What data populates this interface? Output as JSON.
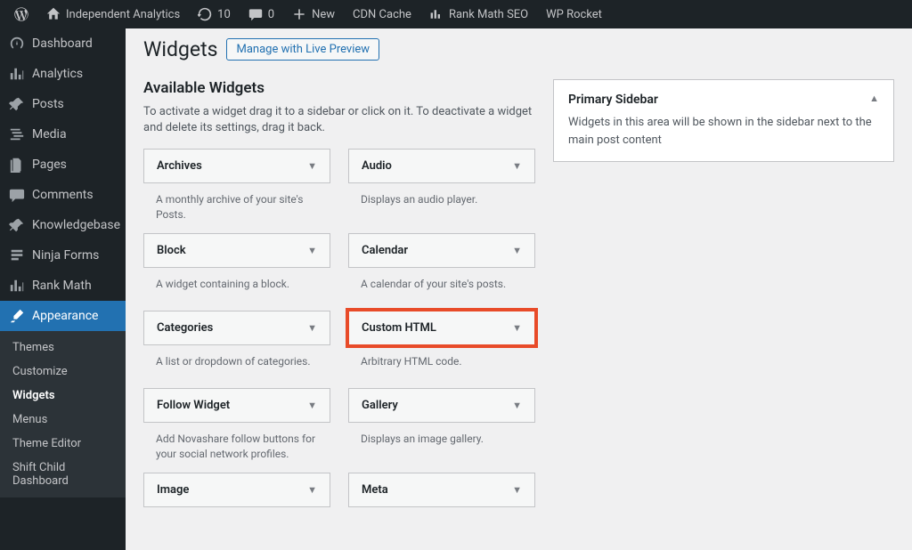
{
  "adminbar": {
    "site_name": "Independent Analytics",
    "updates": "10",
    "comments": "0",
    "new_label": "New",
    "cdn_label": "CDN Cache",
    "rankmath_label": "Rank Math SEO",
    "wprocket_label": "WP Rocket"
  },
  "menu": {
    "items": [
      {
        "key": "dashboard",
        "label": "Dashboard",
        "icon": "dashboard"
      },
      {
        "key": "analytics",
        "label": "Analytics",
        "icon": "chart"
      },
      {
        "key": "posts",
        "label": "Posts",
        "icon": "pin"
      },
      {
        "key": "media",
        "label": "Media",
        "icon": "media"
      },
      {
        "key": "pages",
        "label": "Pages",
        "icon": "pages"
      },
      {
        "key": "comments",
        "label": "Comments",
        "icon": "comment"
      },
      {
        "key": "knowledgebase",
        "label": "Knowledgebase",
        "icon": "pin"
      },
      {
        "key": "ninja_forms",
        "label": "Ninja Forms",
        "icon": "form"
      },
      {
        "key": "rank_math",
        "label": "Rank Math",
        "icon": "chart"
      },
      {
        "key": "appearance",
        "label": "Appearance",
        "icon": "brush"
      }
    ],
    "submenu": [
      "Themes",
      "Customize",
      "Widgets",
      "Menus",
      "Theme Editor",
      "Shift Child Dashboard"
    ],
    "current_sub": "Widgets"
  },
  "page": {
    "title": "Widgets",
    "manage_label": "Manage with Live Preview",
    "available_heading": "Available Widgets",
    "available_desc": "To activate a widget drag it to a sidebar or click on it. To deactivate a widget and delete its settings, drag it back."
  },
  "widgets": [
    {
      "title": "Archives",
      "desc": "A monthly archive of your site's Posts."
    },
    {
      "title": "Audio",
      "desc": "Displays an audio player."
    },
    {
      "title": "Block",
      "desc": "A widget containing a block."
    },
    {
      "title": "Calendar",
      "desc": "A calendar of your site's posts."
    },
    {
      "title": "Categories",
      "desc": "A list or dropdown of categories."
    },
    {
      "title": "Custom HTML",
      "desc": "Arbitrary HTML code.",
      "highlight": true
    },
    {
      "title": "Follow Widget",
      "desc": "Add Novashare follow buttons for your social network profiles."
    },
    {
      "title": "Gallery",
      "desc": "Displays an image gallery."
    },
    {
      "title": "Image",
      "desc": ""
    },
    {
      "title": "Meta",
      "desc": ""
    }
  ],
  "sidebar_area": {
    "title": "Primary Sidebar",
    "desc": "Widgets in this area will be shown in the sidebar next to the main post content"
  }
}
